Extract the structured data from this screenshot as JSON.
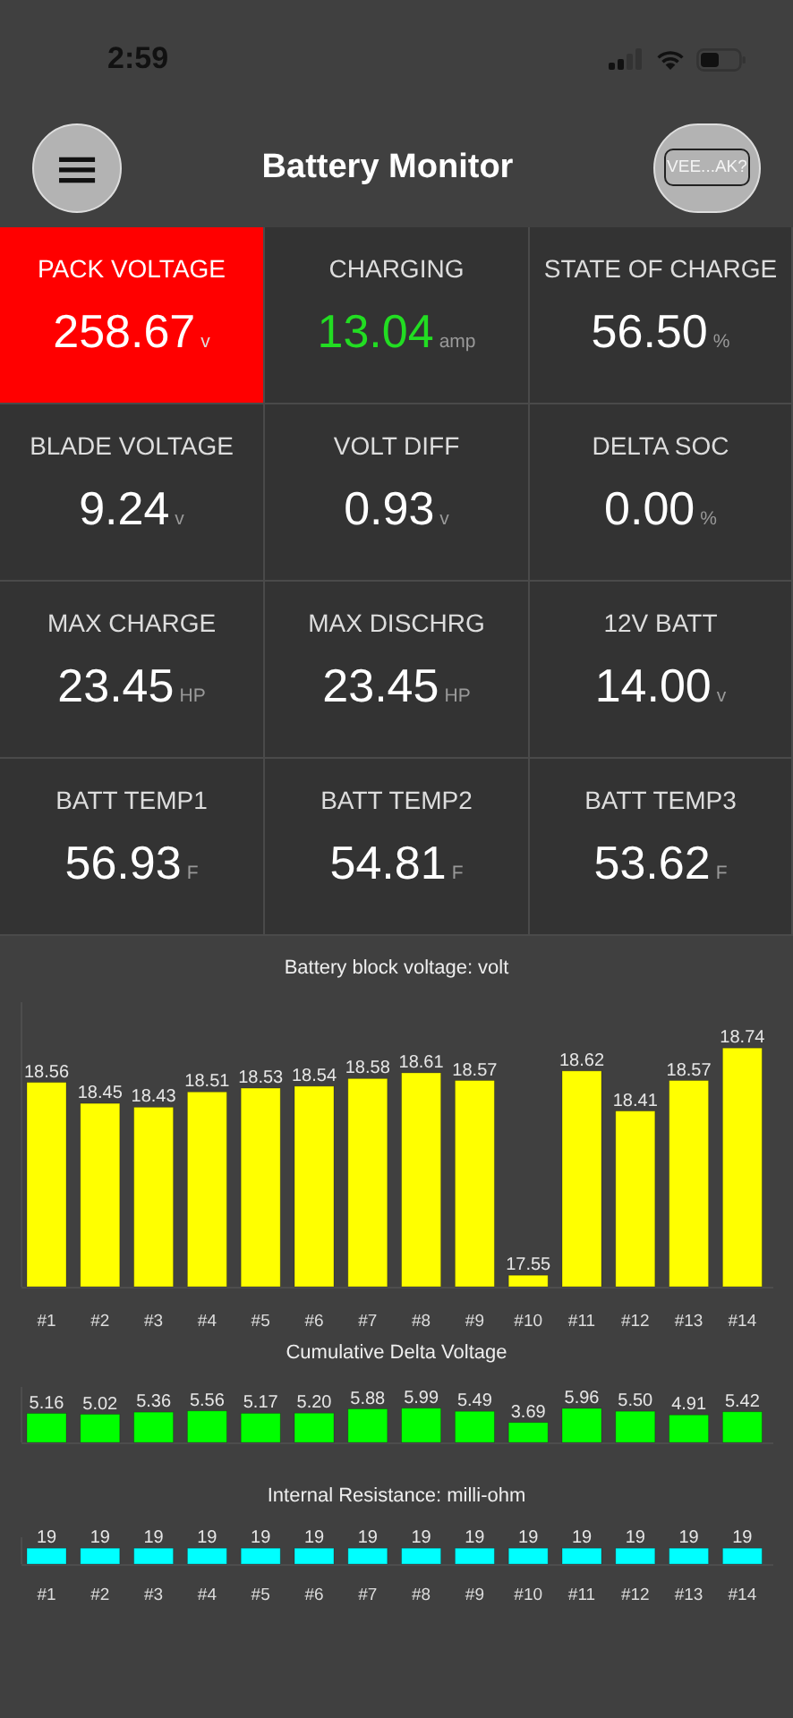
{
  "status_bar": {
    "time": "2:59"
  },
  "header": {
    "title": "Battery Monitor",
    "menu_button": "≡",
    "action_button": "VEE...AK?"
  },
  "tiles": [
    {
      "label": "PACK VOLTAGE",
      "value": "258.67",
      "unit": "v",
      "alert": true,
      "color": "#ffffff"
    },
    {
      "label": "CHARGING",
      "value": "13.04",
      "unit": "amp",
      "alert": false,
      "color": "#22dd22"
    },
    {
      "label": "STATE OF CHARGE",
      "value": "56.50",
      "unit": "%",
      "alert": false,
      "color": "#ffffff"
    },
    {
      "label": "BLADE VOLTAGE",
      "value": "9.24",
      "unit": "v",
      "alert": false,
      "color": "#ffffff"
    },
    {
      "label": "VOLT DIFF",
      "value": "0.93",
      "unit": "v",
      "alert": false,
      "color": "#ffffff"
    },
    {
      "label": "DELTA SOC",
      "value": "0.00",
      "unit": "%",
      "alert": false,
      "color": "#ffffff"
    },
    {
      "label": "MAX CHARGE",
      "value": "23.45",
      "unit": "HP",
      "alert": false,
      "color": "#ffffff"
    },
    {
      "label": "MAX DISCHRG",
      "value": "23.45",
      "unit": "HP",
      "alert": false,
      "color": "#ffffff"
    },
    {
      "label": "12V BATT",
      "value": "14.00",
      "unit": "v",
      "alert": false,
      "color": "#ffffff"
    },
    {
      "label": "BATT TEMP1",
      "value": "56.93",
      "unit": "F",
      "alert": false,
      "color": "#ffffff"
    },
    {
      "label": "BATT TEMP2",
      "value": "54.81",
      "unit": "F",
      "alert": false,
      "color": "#ffffff"
    },
    {
      "label": "BATT TEMP3",
      "value": "53.62",
      "unit": "F",
      "alert": false,
      "color": "#ffffff"
    }
  ],
  "charts": [
    {
      "chart_data": {
        "type": "bar",
        "title": "Battery block voltage: volt",
        "categories": [
          "#1",
          "#2",
          "#3",
          "#4",
          "#5",
          "#6",
          "#7",
          "#8",
          "#9",
          "#10",
          "#11",
          "#12",
          "#13",
          "#14"
        ],
        "ylim": [
          17.49,
          18.98
        ],
        "data_labels": true,
        "series": [
          {
            "color": "#ffff00",
            "values": [
              18.56,
              18.45,
              18.43,
              18.51,
              18.53,
              18.54,
              18.58,
              18.61,
              18.57,
              17.55,
              18.62,
              18.41,
              18.57,
              18.74
            ],
            "value_labels": [
              "18.56",
              "18.45",
              "18.43",
              "18.51",
              "18.53",
              "18.54",
              "18.58",
              "18.61",
              "18.57",
              "17.55",
              "18.62",
              "18.41",
              "18.57",
              "18.74"
            ]
          }
        ]
      }
    },
    {
      "chart_data": {
        "type": "bar",
        "title": "Cumulative Delta Voltage",
        "ylim": [
          0.5,
          9.4
        ],
        "data_labels": true,
        "series": [
          {
            "color": "#00ff00",
            "values": [
              5.16,
              5.02,
              5.36,
              5.56,
              5.17,
              5.2,
              5.88,
              5.99,
              5.49,
              3.69,
              5.96,
              5.5,
              4.91,
              5.42
            ],
            "value_labels": [
              "5.16",
              "5.02",
              "5.36",
              "5.56",
              "5.17",
              "5.20",
              "5.88",
              "5.99",
              "5.49",
              "3.69",
              "5.96",
              "5.50",
              "4.91",
              "5.42"
            ]
          }
        ]
      }
    },
    {
      "chart_data": {
        "type": "bar",
        "title": "Internal Resistance: milli-ohm",
        "categories": [
          "#1",
          "#2",
          "#3",
          "#4",
          "#5",
          "#6",
          "#7",
          "#8",
          "#9",
          "#10",
          "#11",
          "#12",
          "#13",
          "#14"
        ],
        "ylim": [
          0,
          32
        ],
        "data_labels": true,
        "series": [
          {
            "color": "#00ffff",
            "values": [
              19,
              19,
              19,
              19,
              19,
              19,
              19,
              19,
              19,
              19,
              19,
              19,
              19,
              19
            ],
            "value_labels": [
              "19",
              "19",
              "19",
              "19",
              "19",
              "19",
              "19",
              "19",
              "19",
              "19",
              "19",
              "19",
              "19",
              "19"
            ]
          }
        ]
      }
    }
  ]
}
